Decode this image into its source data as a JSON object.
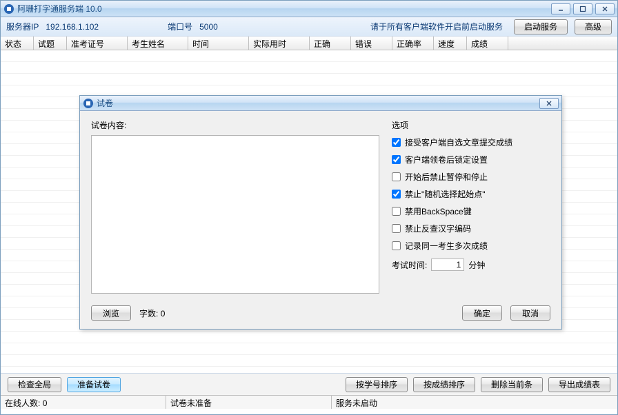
{
  "app": {
    "title": "阿珊打字通服务端 10.0"
  },
  "toolbar": {
    "server_ip_label": "服务器IP",
    "server_ip": "192.168.1.102",
    "port_label": "端口号",
    "port": "5000",
    "hint": "请于所有客户端软件开启前启动服务",
    "start_service": "启动服务",
    "advanced": "高级"
  },
  "columns": [
    "状态",
    "试题",
    "准考证号",
    "考生姓名",
    "时间",
    "实际用时",
    "正确",
    "错误",
    "正确率",
    "速度",
    "成绩"
  ],
  "bottom": {
    "check_all": "检查全局",
    "prepare_paper": "准备试卷",
    "sort_by_id": "按学号排序",
    "sort_by_score": "按成绩排序",
    "delete_current": "删除当前条",
    "export_scores": "导出成绩表"
  },
  "status": {
    "online_label": "在线人数:",
    "online_count": "0",
    "paper_status": "试卷未准备",
    "service_status": "服务未启动"
  },
  "dialog": {
    "title": "试卷",
    "content_label": "试卷内容:",
    "content_value": "",
    "options_label": "选项",
    "opts": [
      {
        "label": "接受客户端自选文章提交成绩",
        "checked": true
      },
      {
        "label": "客户端领卷后锁定设置",
        "checked": true
      },
      {
        "label": "开始后禁止暂停和停止",
        "checked": false
      },
      {
        "label": "禁止\"随机选择起始点\"",
        "checked": true
      },
      {
        "label": "禁用BackSpace键",
        "checked": false
      },
      {
        "label": "禁止反查汉字编码",
        "checked": false
      },
      {
        "label": "记录同一考生多次成绩",
        "checked": false
      }
    ],
    "exam_time_label": "考试时间:",
    "exam_time_value": "1",
    "exam_time_unit": "分钟",
    "browse": "浏览",
    "wordcount_label": "字数:",
    "wordcount": "0",
    "ok": "确定",
    "cancel": "取消"
  }
}
